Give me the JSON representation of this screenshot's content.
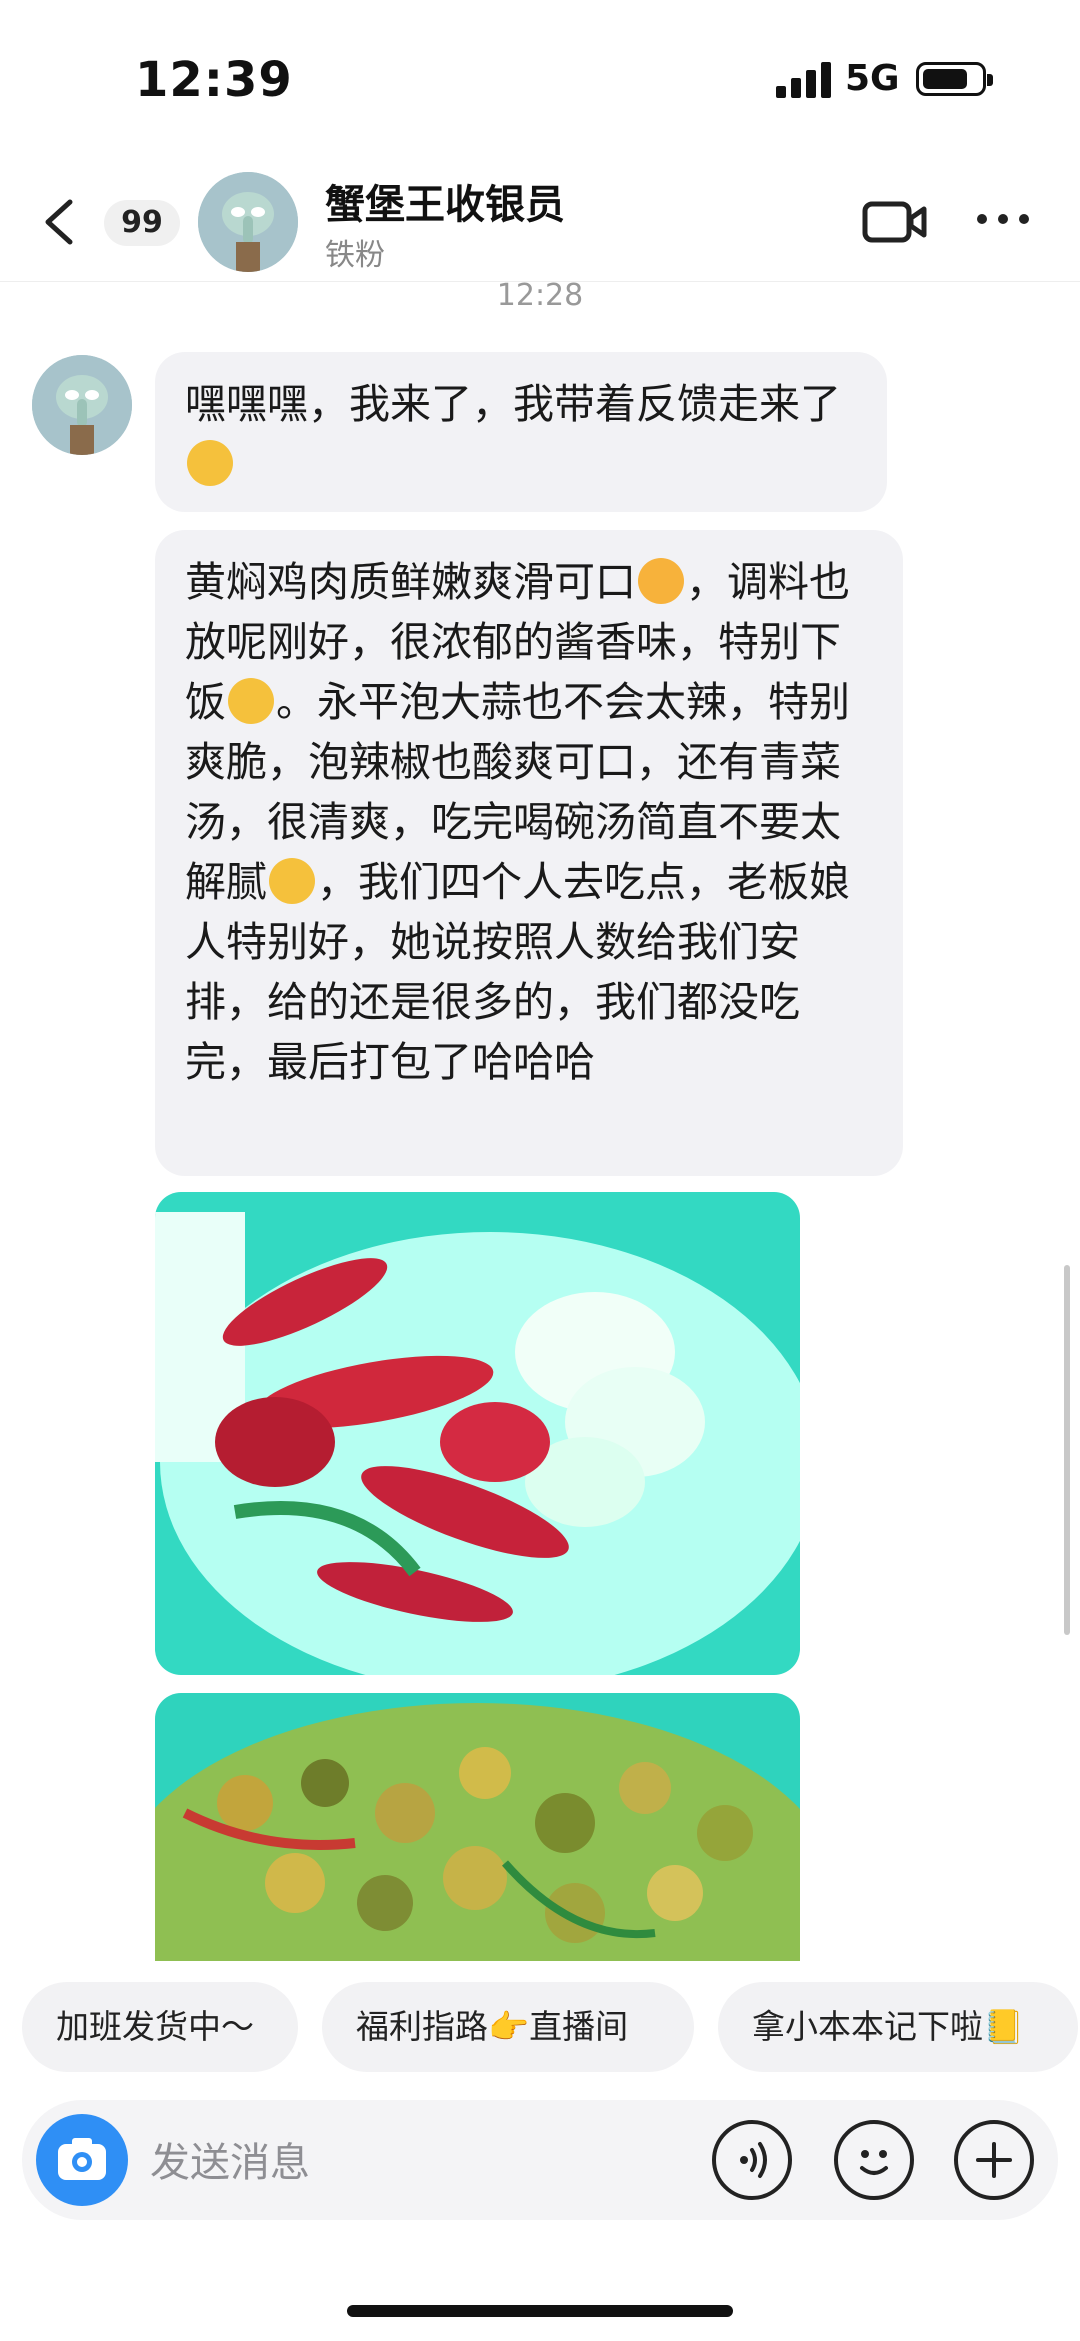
{
  "status_bar": {
    "time": "12:39",
    "network": "5G"
  },
  "header": {
    "unread_count": "99",
    "contact_name": "蟹堡王收银员",
    "contact_subtitle": "铁粉"
  },
  "chat": {
    "timestamp": "12:28",
    "message_1": {
      "part_1": "嘿嘿嘿，我来了，我带着反馈走来了",
      "emoji_1": "thinking-face-emoji"
    },
    "message_2": {
      "part_1": "黄焖鸡肉质鲜嫩爽滑可口",
      "emoji_1": "smiling-face-with-hearts-emoji",
      "part_2": "，调料也放呢刚好，很浓郁的酱香味，特别下饭",
      "emoji_2": "star-struck-emoji",
      "part_3": "。永平泡大蒜也不会太辣，特别爽脆，泡辣椒也酸爽可口，还有青菜汤，很清爽，吃完喝碗汤简直不要太解腻",
      "emoji_3": "face-savoring-food-emoji",
      "part_4": "，我们四个人去吃点，老板娘人特别好，她说按照人数给我们安排，给的还是很多的，我们都没吃完，最后打包了哈哈哈"
    },
    "photo_1": {
      "label": "photo-pickled-chili-and-garlic"
    },
    "photo_2": {
      "label": "photo-braised-chicken-dish"
    }
  },
  "quick_replies": [
    "加班发货中～",
    "福利指路👉直播间",
    "拿小本本记下啦📒"
  ],
  "input": {
    "placeholder": "发送消息"
  },
  "colors": {
    "accent": "#2f8ff5",
    "bubble": "#f2f2f5",
    "photo_tint": "#3ee8cf"
  }
}
